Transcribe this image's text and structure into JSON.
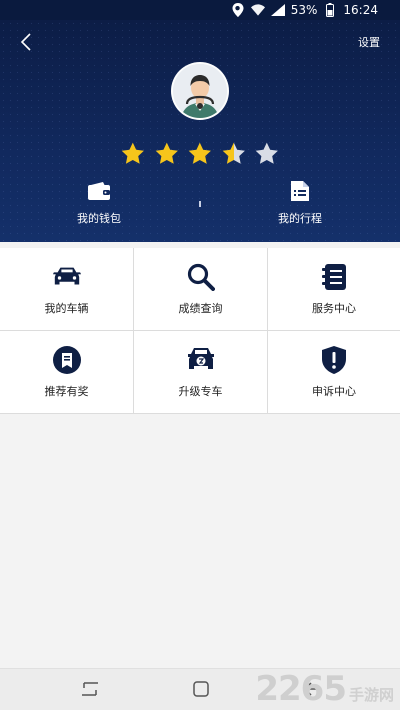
{
  "status_bar": {
    "battery": "53%",
    "time": "16:24",
    "icons": [
      "location-icon",
      "wifi-icon",
      "signal-icon",
      "battery-icon"
    ]
  },
  "header": {
    "settings_label": "设置",
    "back_icon": "back-chevron-icon",
    "rating": {
      "value": 3.5,
      "max": 5
    },
    "quick_items": [
      {
        "icon": "wallet-icon",
        "label": "我的钱包"
      },
      {
        "icon": "trip-list-icon",
        "label": "我的行程"
      }
    ]
  },
  "grid": [
    {
      "icon": "car-icon",
      "label": "我的车辆"
    },
    {
      "icon": "search-icon",
      "label": "成绩查询"
    },
    {
      "icon": "service-book-icon",
      "label": "服务中心"
    },
    {
      "icon": "recommend-badge-icon",
      "label": "推荐有奖"
    },
    {
      "icon": "upgrade-car-icon",
      "label": "升级专车"
    },
    {
      "icon": "shield-alert-icon",
      "label": "申诉中心"
    }
  ],
  "watermark": {
    "number": "2265",
    "text": "手游网"
  },
  "colors": {
    "header_bg": "#11295e",
    "star_filled": "#f6c51b",
    "star_empty": "#d9dde6",
    "icon_dark": "#0f1f44"
  }
}
